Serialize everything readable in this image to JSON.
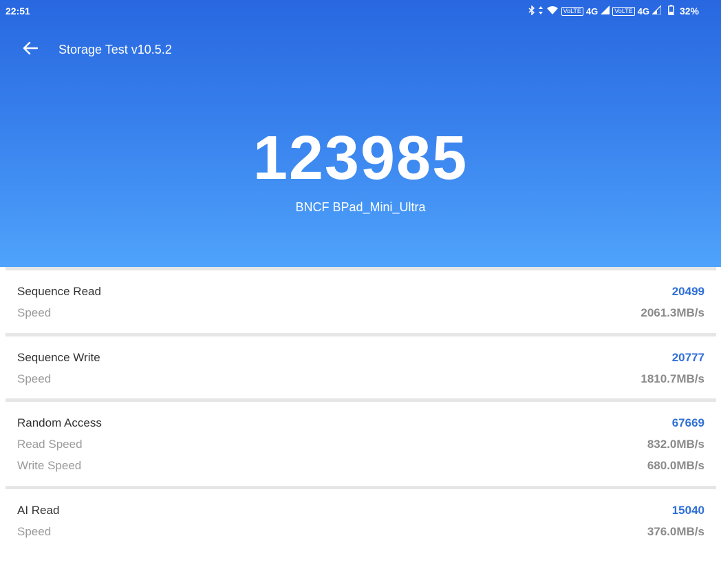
{
  "status_bar": {
    "time": "22:51",
    "network_badge_1": "VoLTE",
    "network_type_1": "4G",
    "network_badge_2": "VoLTE",
    "network_type_2": "4G",
    "battery_percent": "32%",
    "icons": [
      "bluetooth-icon",
      "data-arrows-icon",
      "wifi-icon",
      "signal-icon",
      "signal-icon",
      "battery-icon"
    ]
  },
  "toolbar": {
    "title": "Storage Test v10.5.2",
    "back_icon": "arrow-left-icon"
  },
  "summary": {
    "score": "123985",
    "device": "BNCF BPad_Mini_Ultra"
  },
  "colors": {
    "header_top": "#2867e0",
    "header_bottom": "#4fa3fb",
    "score_value": "#2f6fd6",
    "separator": "#e6e6e6"
  },
  "results": [
    {
      "name": "Sequence Read",
      "score": "20499",
      "metrics": [
        {
          "label": "Speed",
          "value": "2061.3MB/s"
        }
      ]
    },
    {
      "name": "Sequence Write",
      "score": "20777",
      "metrics": [
        {
          "label": "Speed",
          "value": "1810.7MB/s"
        }
      ]
    },
    {
      "name": "Random Access",
      "score": "67669",
      "metrics": [
        {
          "label": "Read Speed",
          "value": "832.0MB/s"
        },
        {
          "label": "Write Speed",
          "value": "680.0MB/s"
        }
      ]
    },
    {
      "name": "AI Read",
      "score": "15040",
      "metrics": [
        {
          "label": "Speed",
          "value": "376.0MB/s"
        }
      ]
    }
  ]
}
